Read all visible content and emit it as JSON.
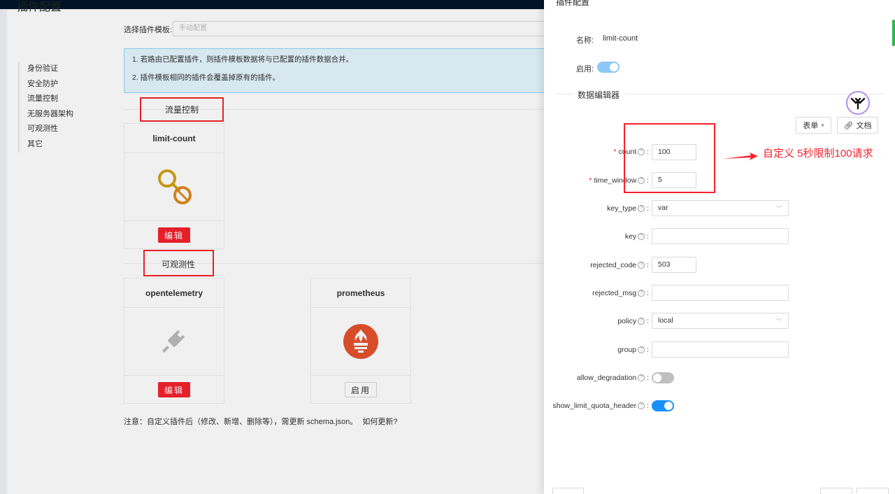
{
  "page": {
    "title": "插件配置",
    "menu": [
      "身份验证",
      "安全防护",
      "流量控制",
      "无服务器架构",
      "可观测性",
      "其它"
    ],
    "template_label": "选择插件模板:",
    "template_placeholder": "手动配置",
    "alerts": [
      "1. 若路由已配置插件，则插件模板数据将与已配置的插件数据合并。",
      "2. 插件模板相同的插件会覆盖掉原有的插件。"
    ],
    "sections": [
      {
        "title": "流量控制",
        "plugins": [
          {
            "name": "limit-count",
            "button": "编辑",
            "icon": "limit-count-icon"
          }
        ]
      },
      {
        "title": "可观测性",
        "plugins": [
          {
            "name": "opentelemetry",
            "button": "编辑",
            "icon": "plug-icon"
          },
          {
            "name": "prometheus",
            "button": "启用",
            "icon": "prometheus-icon"
          }
        ]
      }
    ],
    "note": "注意：自定义插件后（修改、新增、删除等），需更新 schema.json。",
    "note_link": "如何更新?"
  },
  "drawer": {
    "title": "插件配置",
    "name_label": "名称:",
    "name_value": "limit-count",
    "enable_label": "启用:",
    "enable_on": true,
    "section_title": "数据编辑器",
    "form_button": "表单",
    "docs_button": "文档",
    "annotation": "自定义 5秒限制100请求",
    "fields": {
      "count": {
        "label": "count",
        "value": "100",
        "required": true
      },
      "time_window": {
        "label": "time_window",
        "value": "5",
        "required": true
      },
      "key_type": {
        "label": "key_type",
        "value": "var"
      },
      "key": {
        "label": "key",
        "value": ""
      },
      "rejected_code": {
        "label": "rejected_code",
        "value": "503"
      },
      "rejected_msg": {
        "label": "rejected_msg",
        "value": ""
      },
      "policy": {
        "label": "policy",
        "value": "local"
      },
      "group": {
        "label": "group",
        "value": ""
      },
      "allow_degradation": {
        "label": "allow_degradation",
        "on": false
      },
      "show_limit_quota_header": {
        "label": "show_limit_quota_header",
        "on": true
      }
    },
    "colors": {
      "accent": "#1890ff",
      "danger": "#f5222d"
    }
  }
}
